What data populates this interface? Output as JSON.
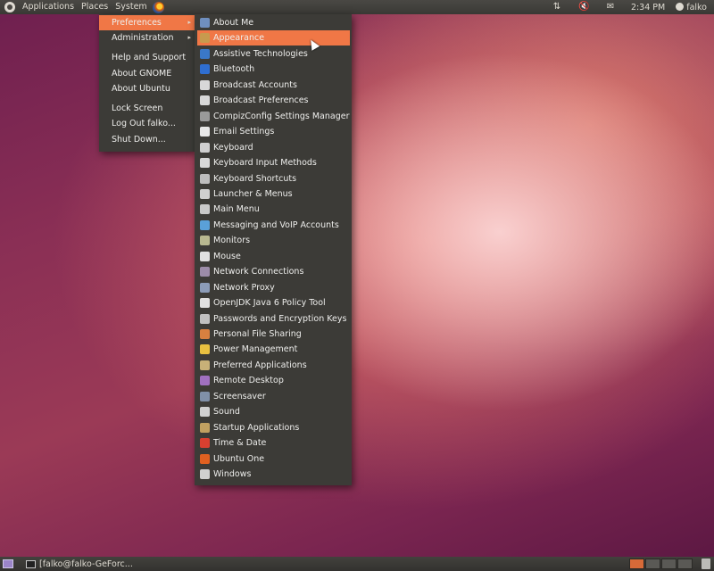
{
  "top_panel": {
    "menus": [
      "Applications",
      "Places",
      "System"
    ],
    "clock": "2:34 PM",
    "user": "falko"
  },
  "system_menu": {
    "items": [
      {
        "label": "Preferences",
        "submenu": true,
        "active": true
      },
      {
        "label": "Administration",
        "submenu": true
      },
      {
        "label": "Help and Support"
      },
      {
        "label": "About GNOME"
      },
      {
        "label": "About Ubuntu"
      },
      {
        "label": "Lock Screen"
      },
      {
        "label": "Log Out falko..."
      },
      {
        "label": "Shut Down..."
      }
    ]
  },
  "preferences_menu": {
    "items": [
      {
        "label": "About Me",
        "icon": "person-icon",
        "color": "#6f8fbf"
      },
      {
        "label": "Appearance",
        "icon": "appearance-icon",
        "color": "#c79a4e",
        "active": true
      },
      {
        "label": "Assistive Technologies",
        "icon": "accessibility-icon",
        "color": "#3a78c8"
      },
      {
        "label": "Bluetooth",
        "icon": "bluetooth-icon",
        "color": "#2f6ed0"
      },
      {
        "label": "Broadcast Accounts",
        "icon": "broadcast-icon",
        "color": "#d8d8d8"
      },
      {
        "label": "Broadcast Preferences",
        "icon": "broadcast-prefs-icon",
        "color": "#d8d8d8"
      },
      {
        "label": "CompizConfig Settings Manager",
        "icon": "compiz-icon",
        "color": "#9a9a9a"
      },
      {
        "label": "Email Settings",
        "icon": "email-icon",
        "color": "#e8e8e8"
      },
      {
        "label": "Keyboard",
        "icon": "keyboard-icon",
        "color": "#cfcfcf"
      },
      {
        "label": "Keyboard Input Methods",
        "icon": "keyboard-input-icon",
        "color": "#d8d8d8"
      },
      {
        "label": "Keyboard Shortcuts",
        "icon": "keyboard-shortcuts-icon",
        "color": "#bdbdbd"
      },
      {
        "label": "Launcher & Menus",
        "icon": "launcher-icon",
        "color": "#d0d0d0"
      },
      {
        "label": "Main Menu",
        "icon": "main-menu-icon",
        "color": "#c8c8c8"
      },
      {
        "label": "Messaging and VoIP Accounts",
        "icon": "messaging-icon",
        "color": "#5aa0d8"
      },
      {
        "label": "Monitors",
        "icon": "monitor-icon",
        "color": "#b8b890"
      },
      {
        "label": "Mouse",
        "icon": "mouse-icon",
        "color": "#e0e0e0"
      },
      {
        "label": "Network Connections",
        "icon": "network-icon",
        "color": "#9c8ca8"
      },
      {
        "label": "Network Proxy",
        "icon": "network-proxy-icon",
        "color": "#8c9cb8"
      },
      {
        "label": "OpenJDK Java 6 Policy Tool",
        "icon": "java-icon",
        "color": "#e0e0e0"
      },
      {
        "label": "Passwords and Encryption Keys",
        "icon": "keys-icon",
        "color": "#c0c0c0"
      },
      {
        "label": "Personal File Sharing",
        "icon": "file-sharing-icon",
        "color": "#d88040"
      },
      {
        "label": "Power Management",
        "icon": "power-icon",
        "color": "#e8c040"
      },
      {
        "label": "Preferred Applications",
        "icon": "preferred-apps-icon",
        "color": "#c8b078"
      },
      {
        "label": "Remote Desktop",
        "icon": "remote-desktop-icon",
        "color": "#a070c0"
      },
      {
        "label": "Screensaver",
        "icon": "screensaver-icon",
        "color": "#8090a8"
      },
      {
        "label": "Sound",
        "icon": "sound-icon",
        "color": "#d0d0d0"
      },
      {
        "label": "Startup Applications",
        "icon": "startup-icon",
        "color": "#c0a060"
      },
      {
        "label": "Time & Date",
        "icon": "calendar-icon",
        "color": "#d84030"
      },
      {
        "label": "Ubuntu One",
        "icon": "ubuntu-one-icon",
        "color": "#e06020"
      },
      {
        "label": "Windows",
        "icon": "windows-icon",
        "color": "#d0d0d0"
      }
    ]
  },
  "bottom_panel": {
    "task_label": "[falko@falko-GeForc..."
  },
  "accent": "#f07746"
}
